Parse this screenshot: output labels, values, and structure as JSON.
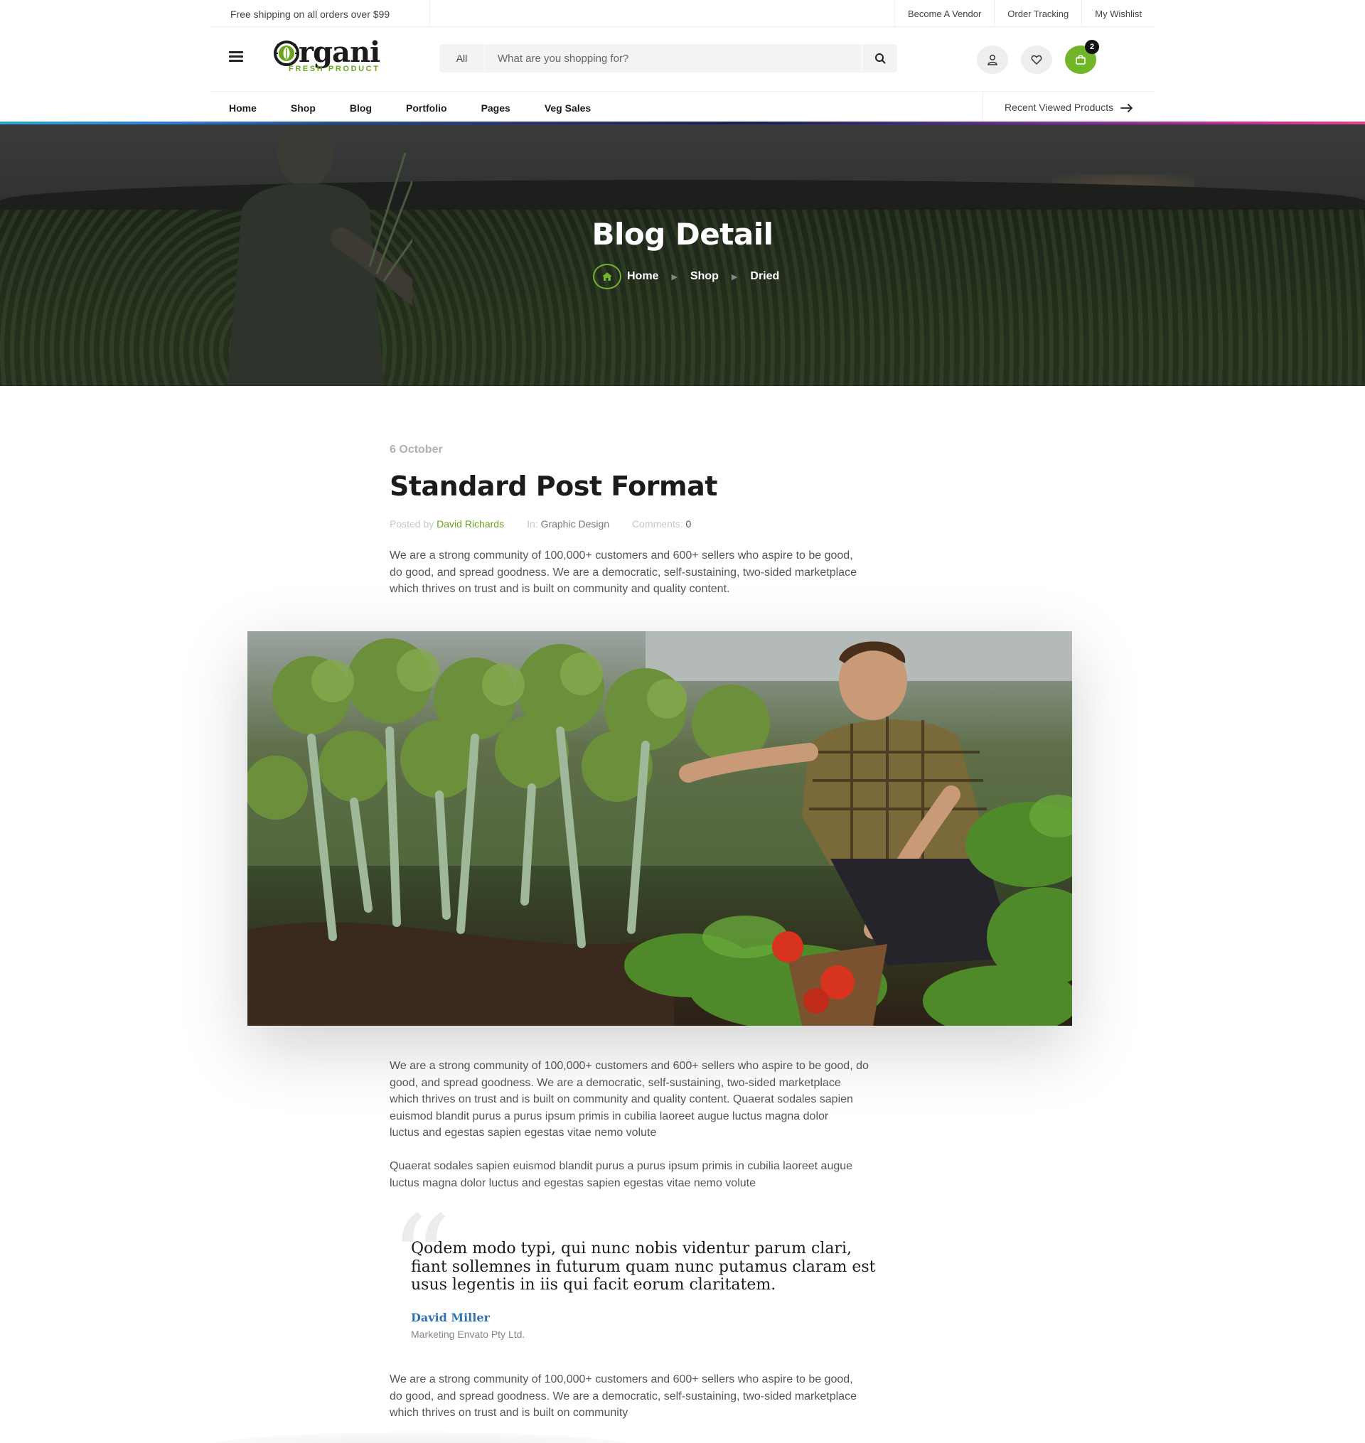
{
  "topbar": {
    "shipping_text": "Free shipping on all orders over $99",
    "links": [
      "Become A Vendor",
      "Order Tracking",
      "My Wishlist"
    ]
  },
  "header": {
    "logo_word": "rgani",
    "logo_sub": "FRESH PRODUCT",
    "search_category": "All",
    "search_placeholder": "What are you shopping for?",
    "cart_count": "2",
    "accent_color": "#72b52a"
  },
  "nav": {
    "items": [
      "Home",
      "Shop",
      "Blog",
      "Portfolio",
      "Pages",
      "Veg Sales"
    ],
    "recent": "Recent Viewed Products"
  },
  "hero": {
    "title": "Blog Detail",
    "breadcrumb": [
      "Home",
      "Shop",
      "Dried"
    ]
  },
  "post": {
    "date": "6 October",
    "title": "Standard Post Format",
    "posted_by_label": "Posted by",
    "author": "David Richards",
    "in_label": "In:",
    "category": "Graphic Design",
    "comments_label": "Comments:",
    "comments_count": "0",
    "intro_lines": [
      "We are a strong community of 100,000+ customers and 600+ sellers who aspire to be good,",
      "do good, and spread goodness. We are a democratic, self-sustaining, two-sided marketplace",
      "which thrives on trust and is built on community and quality content."
    ],
    "body1_lines": [
      "We are a strong community of 100,000+ customers and 600+ sellers who aspire to be good, do",
      "good, and spread goodness. We are a democratic, self-sustaining, two-sided marketplace",
      "which thrives on trust and is built on community and quality content. Quaerat sodales sapien",
      "euismod blandit purus a purus ipsum primis in cubilia laoreet augue luctus magna dolor",
      "luctus and egestas sapien egestas vitae nemo volute"
    ],
    "body2_lines": [
      "Quaerat sodales sapien euismod blandit purus a purus ipsum primis in cubilia laoreet augue",
      "luctus magna dolor luctus and egestas sapien egestas vitae nemo volute"
    ],
    "quote_lines": [
      "Qodem modo typi, qui nunc nobis videntur parum clari,",
      "fiant sollemnes in futurum quam nunc putamus claram est",
      "usus legentis in iis qui facit eorum claritatem."
    ],
    "quote_author": "David Miller",
    "quote_role": "Marketing Envato Pty Ltd.",
    "body3_lines": [
      "We are a strong community of 100,000+ customers and 600+ sellers who aspire to be good,",
      "do good, and spread goodness. We are a democratic, self-sustaining, two-sided marketplace",
      "which thrives on trust and is built on community"
    ]
  }
}
